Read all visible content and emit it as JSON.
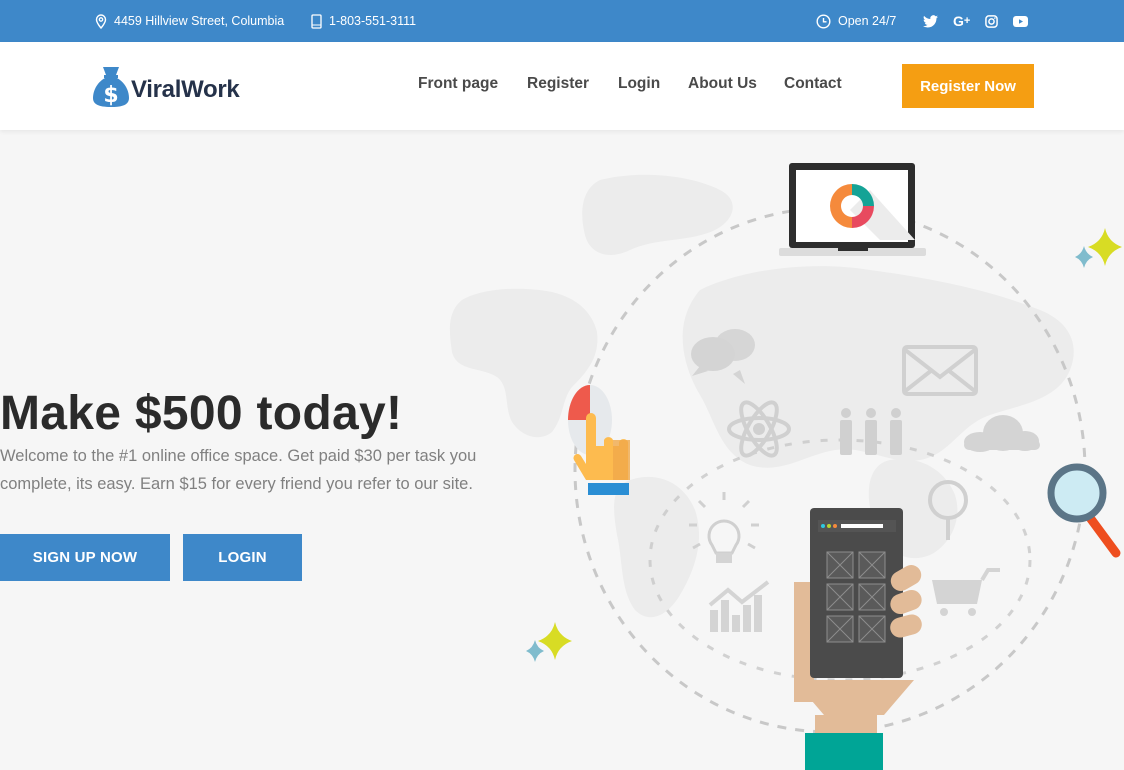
{
  "topbar": {
    "address": "4459 Hillview Street, Columbia",
    "phone": "1-803-551-3111",
    "hours": "Open 24/7",
    "social": [
      "twitter-icon",
      "google-plus-icon",
      "instagram-icon",
      "youtube-icon"
    ],
    "bg_color": "#3e88c9"
  },
  "header": {
    "logo_text": "ViralWork",
    "nav": [
      "Front page",
      "Register",
      "Login",
      "About Us",
      "Contact"
    ],
    "cta_label": "Register Now",
    "cta_color": "#f59e12"
  },
  "hero": {
    "title": "Make $500 today!",
    "text": "Welcome to the #1 online office space. Get paid $30 per task you complete, its easy. Earn $15 for every friend you refer to our site.",
    "signup_label": "SIGN UP NOW",
    "login_label": "LOGIN",
    "button_color": "#3e88c9"
  },
  "illustration": {
    "icons": [
      "laptop-icon",
      "donut-chart-icon",
      "chat-bubbles-icon",
      "envelope-icon",
      "atom-icon",
      "team-icon",
      "cloud-icon",
      "lightbulb-icon",
      "search-icon",
      "growth-chart-icon",
      "shopping-cart-icon",
      "pointing-hand-icon",
      "smartphone-icon",
      "magnifier-icon",
      "sparkle-icon"
    ]
  }
}
